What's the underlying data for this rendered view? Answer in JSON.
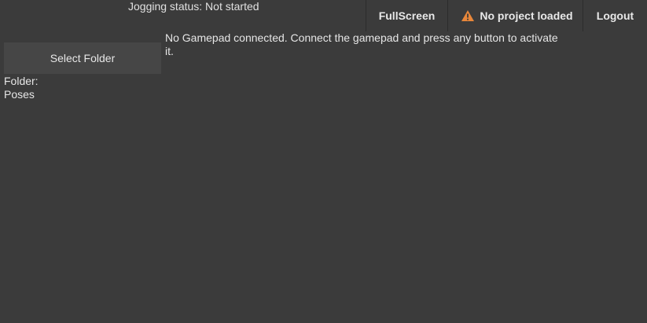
{
  "status": {
    "jogging": "Jogging status: Not started"
  },
  "topbar": {
    "fullscreen_label": "FullScreen",
    "project_label": "No project loaded",
    "project_icon": "warning-icon",
    "logout_label": "Logout",
    "warning_color": "#e8873a"
  },
  "sidebar": {
    "select_folder_label": "Select Folder",
    "folder_label": "Folder:",
    "poses_label": "Poses"
  },
  "main": {
    "gamepad_message": "No Gamepad connected. Connect the gamepad and press any button to activate it."
  },
  "colors": {
    "background": "#3b3b3b",
    "button": "#464646",
    "text": "#e6e6e6"
  }
}
